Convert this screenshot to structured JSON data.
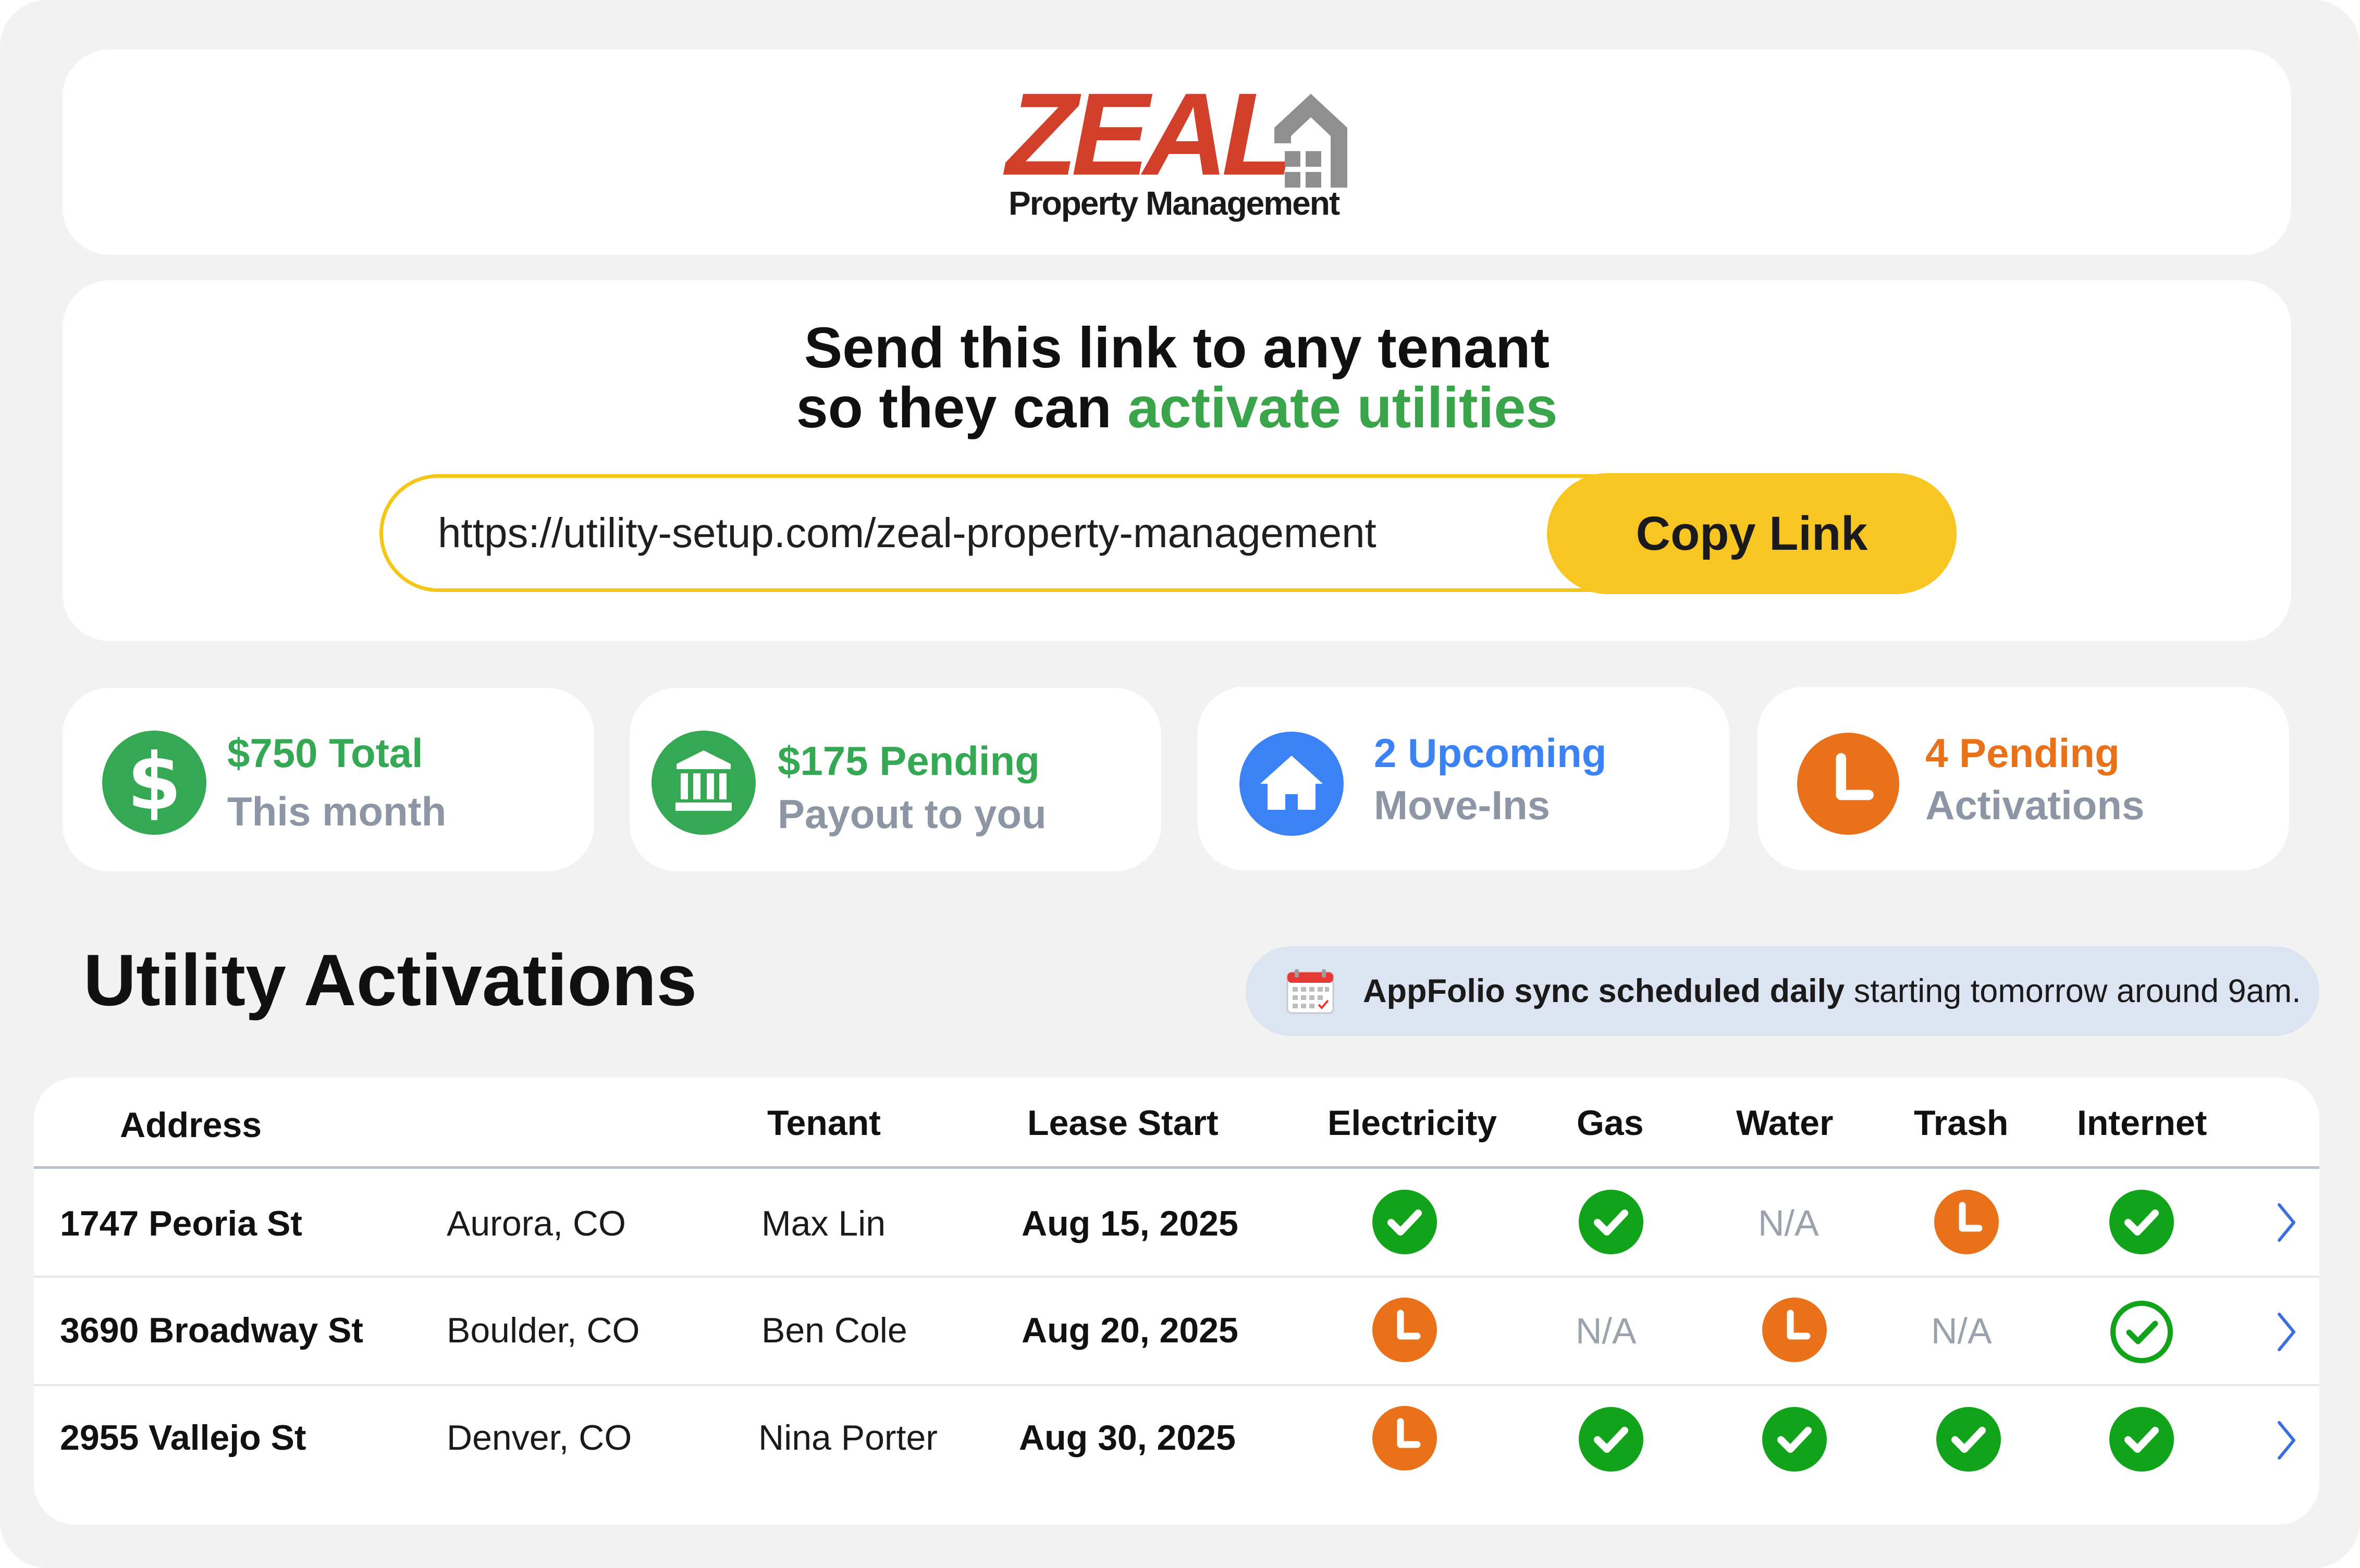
{
  "brand": {
    "name": "ZEAL",
    "subtitle": "Property Management",
    "colors": {
      "red": "#d2402c",
      "gray": "#8f8f8f"
    }
  },
  "share_link": {
    "headline_line1": "Send this link to any tenant",
    "headline_line2_prefix": "so they can ",
    "headline_line2_accent": "activate utilities",
    "url": "https://utility-setup.com/zeal-property-management",
    "copy_button": "Copy Link"
  },
  "stats": [
    {
      "value": "$750 Total",
      "label": "This month",
      "icon": "dollar-icon",
      "color": "#34a853"
    },
    {
      "value": "$175 Pending",
      "label": "Payout to you",
      "icon": "bank-icon",
      "color": "#34a853"
    },
    {
      "value": "2 Upcoming",
      "label": "Move-Ins",
      "icon": "home-icon",
      "color": "#3b82f6"
    },
    {
      "value": "4 Pending",
      "label": "Activations",
      "icon": "clock-icon",
      "color": "#e8711a"
    }
  ],
  "activations": {
    "title": "Utility Activations",
    "sync_banner": {
      "bold": "AppFolio sync scheduled daily",
      "rest": " starting tomorrow around 9am.",
      "icon": "calendar-icon"
    },
    "columns": [
      "Address",
      "Tenant",
      "Lease Start",
      "Electricity",
      "Gas",
      "Water",
      "Trash",
      "Internet"
    ],
    "rows": [
      {
        "address": "1747 Peoria St",
        "city": "Aurora, CO",
        "tenant": "Max Lin",
        "lease_start": "Aug 15, 2025",
        "electricity": "active",
        "gas": "active",
        "water": "N/A",
        "trash": "pending",
        "internet": "active"
      },
      {
        "address": "3690 Broadway St",
        "city": "Boulder, CO",
        "tenant": "Ben Cole",
        "lease_start": "Aug 20, 2025",
        "electricity": "pending",
        "gas": "N/A",
        "water": "pending",
        "trash": "N/A",
        "internet": "confirmed"
      },
      {
        "address": "2955 Vallejo St",
        "city": "Denver, CO",
        "tenant": "Nina Porter",
        "lease_start": "Aug 30, 2025",
        "electricity": "pending",
        "gas": "active",
        "water": "active",
        "trash": "active",
        "internet": "active"
      }
    ]
  },
  "status_colors": {
    "active": "#11a31a",
    "pending": "#e8711a",
    "na": "#9aa3ad"
  }
}
